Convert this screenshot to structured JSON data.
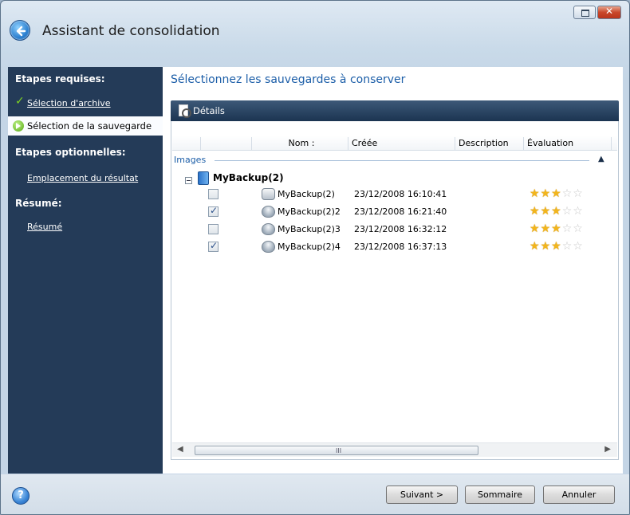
{
  "window": {
    "title": "Assistant de consolidation"
  },
  "sidebar": {
    "required_heading": "Etapes requises:",
    "step_archive": "Sélection d'archive",
    "step_backup": "Sélection de la sauvegarde",
    "optional_heading": "Etapes optionnelles:",
    "step_location": "Emplacement du résultat",
    "summary_heading": "Résumé:",
    "step_summary": "Résumé"
  },
  "main": {
    "heading": "Sélectionnez les sauvegardes à conserver",
    "details_label": "Détails",
    "columns": [
      "Nom :",
      "Créée",
      "Description",
      "Évaluation"
    ],
    "group_label": "Images",
    "archive_name": "MyBackup(2)",
    "rows": [
      {
        "checked": false,
        "name": "MyBackup(2)",
        "created": "23/12/2008 16:10:41",
        "rating": 3,
        "full": true
      },
      {
        "checked": true,
        "name": "MyBackup(2)2",
        "created": "23/12/2008 16:21:40",
        "rating": 3,
        "full": false
      },
      {
        "checked": false,
        "name": "MyBackup(2)3",
        "created": "23/12/2008 16:32:12",
        "rating": 3,
        "full": false
      },
      {
        "checked": true,
        "name": "MyBackup(2)4",
        "created": "23/12/2008 16:37:13",
        "rating": 3,
        "full": false
      }
    ],
    "rating_max": 5
  },
  "footer": {
    "next_label": "Suivant >",
    "next_key": "S",
    "summary_label": "Sommaire",
    "summary_key": "S",
    "cancel_label": "Annuler",
    "cancel_key": "A"
  },
  "colors": {
    "sidebar_bg": "#243b58",
    "accent_text": "#1c5ea8",
    "star_on": "#f2b51c"
  }
}
